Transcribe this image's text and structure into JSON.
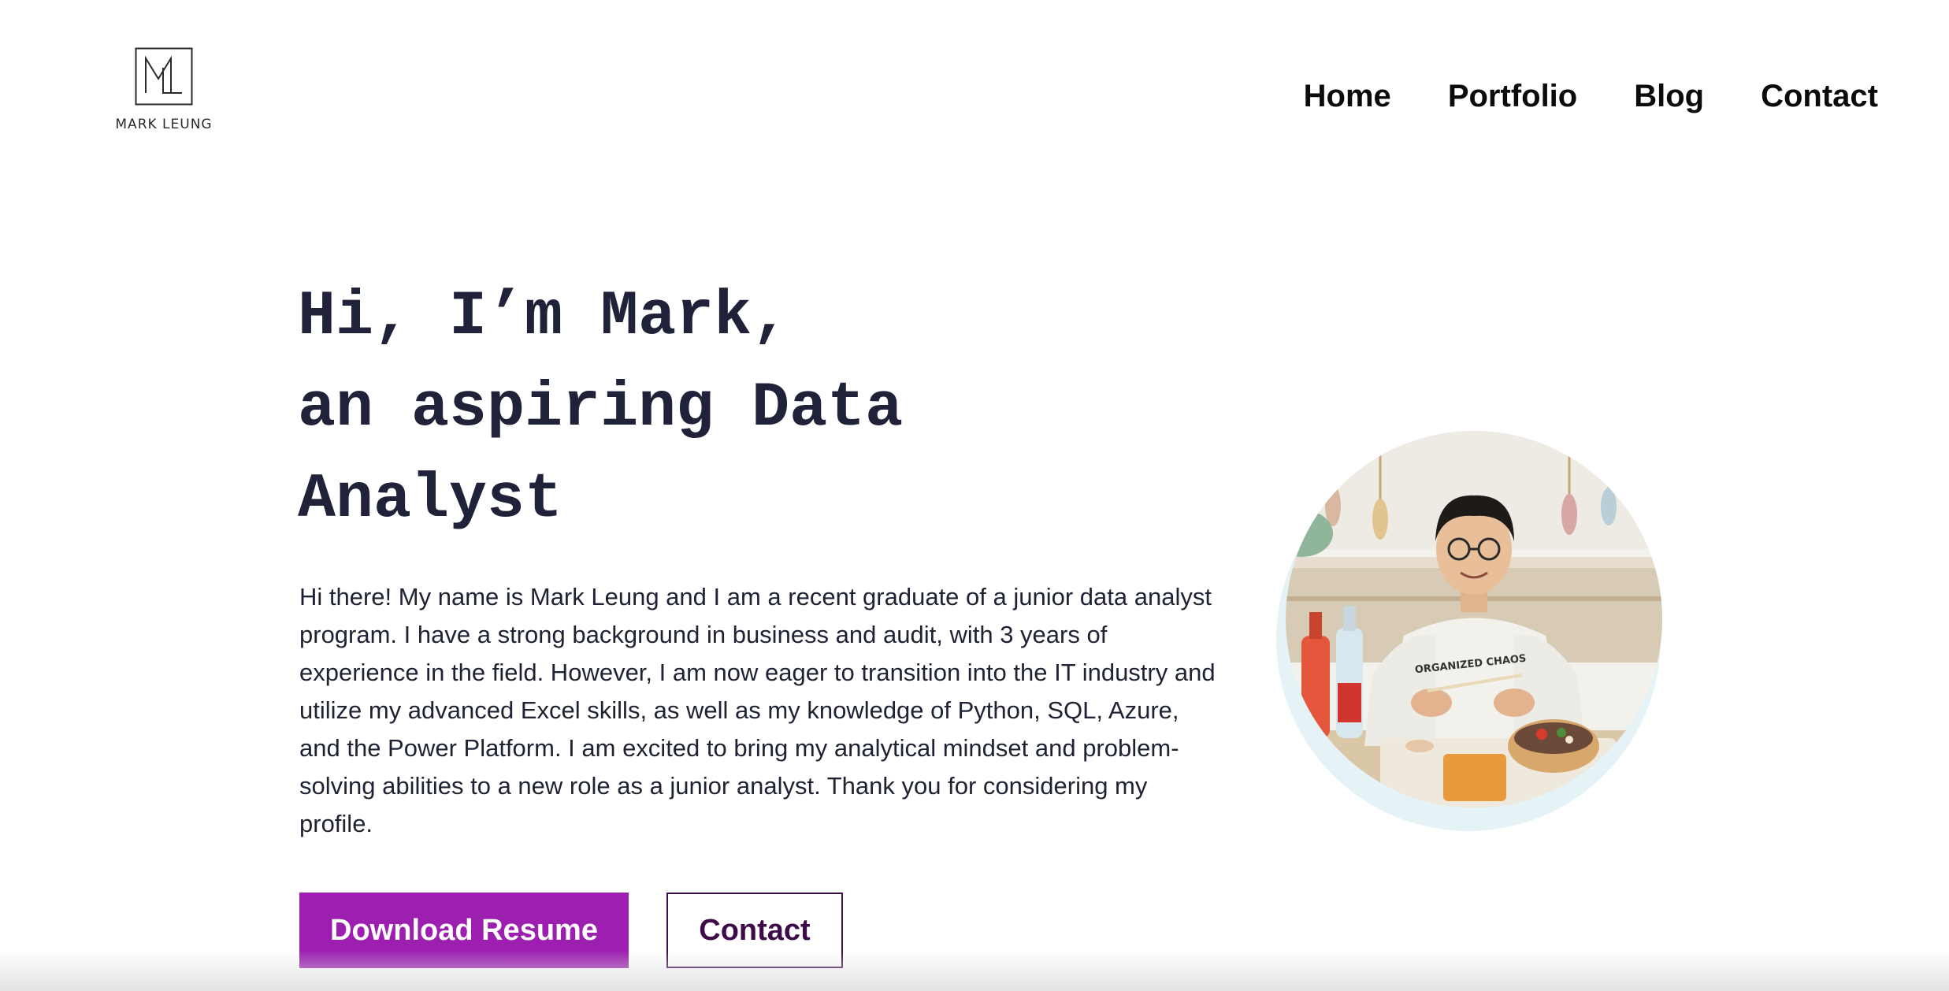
{
  "header": {
    "logo_text": "MARK LEUNG",
    "logo_icon": "ml-monogram-logo",
    "nav": [
      {
        "label": "Home"
      },
      {
        "label": "Portfolio"
      },
      {
        "label": "Blog"
      },
      {
        "label": "Contact"
      }
    ]
  },
  "hero": {
    "title_lines": [
      "Hi, I’m Mark,",
      "an aspiring Data",
      "Analyst"
    ],
    "intro": "Hi there! My name is Mark Leung and I am a recent graduate of a junior data analyst program. I have a strong background in business and audit, with 3 years of experience in the field. However, I am now eager to transition into the IT industry and utilize my advanced Excel skills, as well as my knowledge of Python, SQL, Azure, and the Power Platform. I am excited to bring my analytical mindset and problem-solving abilities to a new role as a junior analyst. Thank you for considering my profile.",
    "primary_button": "Download Resume",
    "secondary_button": "Contact",
    "photo_icon": "profile-photo",
    "photo_tshirt_text": "ORGANIZED CHAOS"
  },
  "colors": {
    "accent": "#9c1fb0",
    "outline_button": "#3d0a4a",
    "heading": "#1f2238",
    "photo_ring": "#e6f3f6"
  }
}
